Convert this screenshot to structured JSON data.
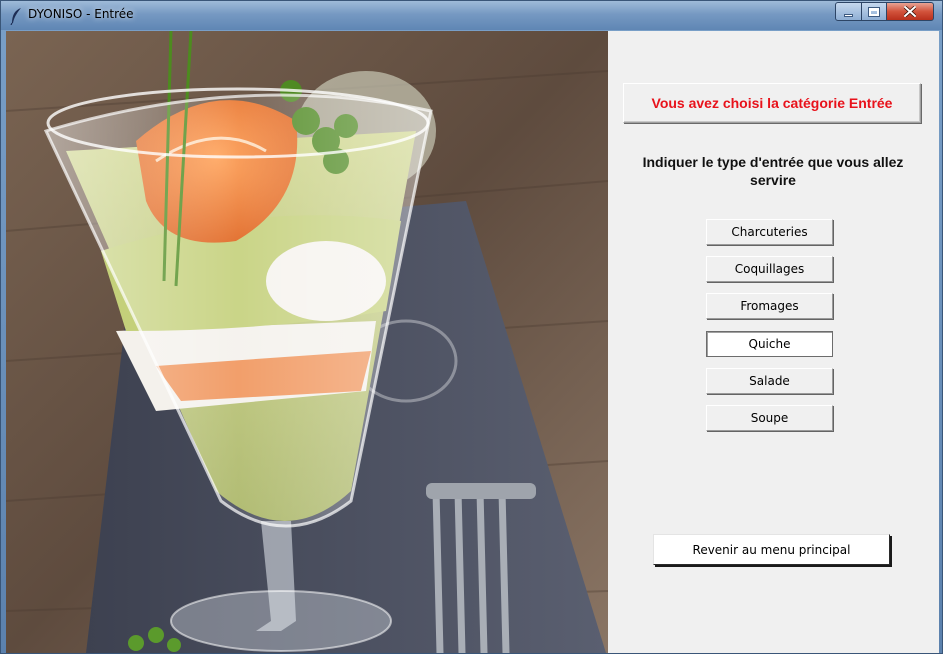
{
  "window": {
    "title": "DYONISO - Entrée",
    "icon": "feather-icon",
    "controls": [
      "minimize-icon",
      "maximize-icon",
      "close-icon"
    ]
  },
  "image": {
    "subject": "verrine-photo",
    "icon": "food-photo"
  },
  "panel": {
    "category_text": "Vous avez choisi la catégorie Entrée",
    "category_color": "#e8121b",
    "instruction": "Indiquer le type d'entrée que vous allez servire",
    "choices": [
      {
        "label": "Charcuteries"
      },
      {
        "label": "Coquillages"
      },
      {
        "label": "Fromages"
      },
      {
        "label": "Quiche"
      },
      {
        "label": "Salade"
      },
      {
        "label": "Soupe"
      }
    ],
    "active_choice": "Quiche",
    "back_label": "Revenir au menu principal"
  }
}
